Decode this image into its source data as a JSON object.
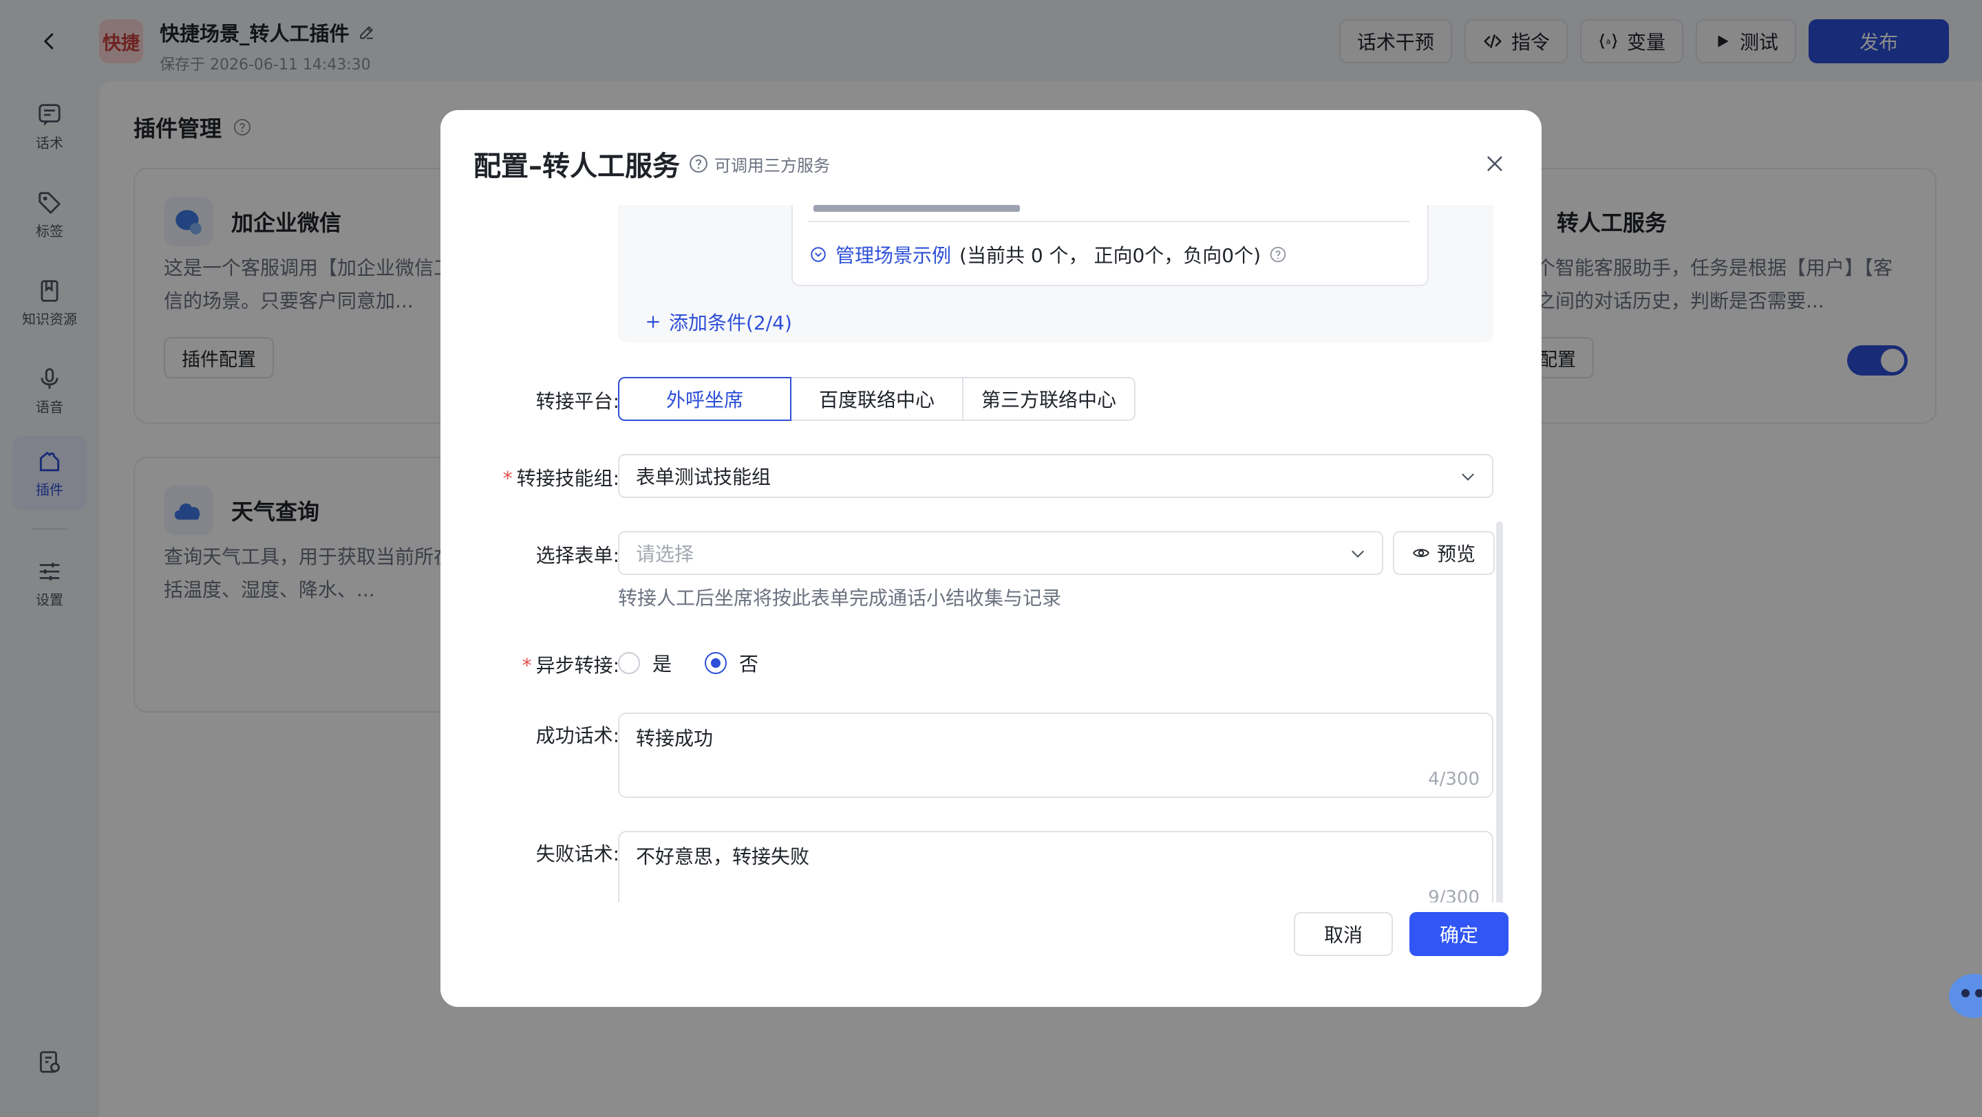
{
  "header": {
    "back_icon": "chevron-left-icon",
    "badge": "快捷",
    "title": "快捷场景_转人工插件",
    "edit_icon": "pencil-icon",
    "saved_at": "保存于 2026-06-11 14:43:30",
    "actions": {
      "intervene": "话术干预",
      "command": "指令",
      "variable": "变量",
      "test": "测试",
      "publish": "发布"
    },
    "accent": "#2d4fd7"
  },
  "sidebar": {
    "items": [
      {
        "label": "话术",
        "icon": "message-icon"
      },
      {
        "label": "标签",
        "icon": "tag-icon"
      },
      {
        "label": "知识资源",
        "icon": "book-icon"
      },
      {
        "label": "语音",
        "icon": "microphone-icon"
      },
      {
        "label": "插件",
        "icon": "plugin-icon",
        "active": true
      },
      {
        "label": "设置",
        "icon": "sliders-icon"
      }
    ],
    "bottom_icon": "document-settings-icon"
  },
  "main": {
    "page_title": "插件管理",
    "cards": [
      {
        "name": "加企业微信",
        "desc": "这是一个客服调用【加企业微信工具】用户微信的场景。只要客户同意加...",
        "button": "插件配置"
      },
      {
        "name": "转人工服务",
        "desc": "是一个智能客服助手，任务是根据【用户】【客服】之间的对话历史，判断是否需要...",
        "button": "插件配置",
        "enabled": true
      },
      {
        "name": "天气查询",
        "desc": "查询天气工具，用于获取当前所在气信息（包括温度、湿度、降水、..."
      }
    ]
  },
  "modal": {
    "title": "配置–转人工服务",
    "hint": "可调用三方服务",
    "conditions": {
      "manage_link": "管理场景示例",
      "stat": "(当前共 0 个， 正向0个，负向0个)",
      "add": "添加条件(2/4)"
    },
    "platform": {
      "label": "转接平台:",
      "options": [
        "外呼坐席",
        "百度联络中心",
        "第三方联络中心"
      ],
      "selected": "外呼坐席"
    },
    "skill_group": {
      "label": "转接技能组:",
      "value": "表单测试技能组"
    },
    "form_select": {
      "label": "选择表单:",
      "placeholder": "请选择",
      "preview": "预览",
      "help": "转接人工后坐席将按此表单完成通话小结收集与记录"
    },
    "async_transfer": {
      "label": "异步转接:",
      "yes": "是",
      "no": "否",
      "selected": "否"
    },
    "success_script": {
      "label": "成功话术:",
      "value": "转接成功",
      "counter": "4/300"
    },
    "fail_script": {
      "label": "失败话术:",
      "value": "不好意思，转接失败",
      "counter": "9/300"
    },
    "cancel": "取消",
    "confirm": "确定"
  }
}
